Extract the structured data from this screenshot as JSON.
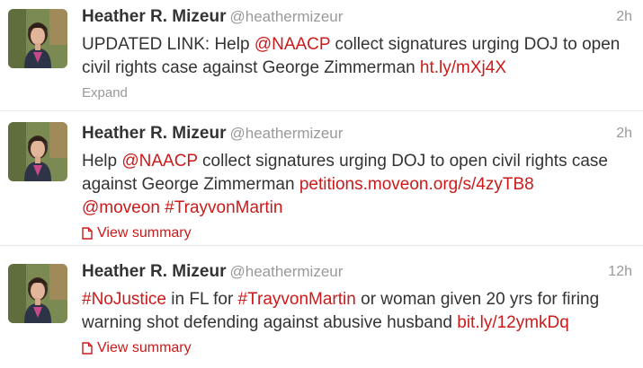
{
  "colors": {
    "link": "#cc1a1a",
    "muted": "#999999",
    "text": "#333333",
    "divider": "#e8e8e8"
  },
  "tweets": [
    {
      "fullname": "Heather R. Mizeur",
      "username": "@heathermizeur",
      "time": "2h",
      "avatar_icon": "profile-photo",
      "text": {
        "p1": "UPDATED LINK: Help ",
        "m1": "@NAACP",
        "p2": " collect signatures urging DOJ to open civil rights case against George Zimmerman ",
        "l1": "ht.ly/mXj4X"
      },
      "action": "Expand"
    },
    {
      "fullname": "Heather R. Mizeur",
      "username": "@heathermizeur",
      "time": "2h",
      "avatar_icon": "profile-photo",
      "text": {
        "p1": "Help ",
        "m1": "@NAACP",
        "p2": " collect signatures urging DOJ to open civil rights case against George Zimmerman ",
        "l1": "petitions.moveon.org/s/4zyTB8",
        "m2": "@moveon",
        "h1": "#TrayvonMartin"
      },
      "action": "View summary",
      "action_icon": "document-icon"
    },
    {
      "fullname": "Heather R. Mizeur",
      "username": "@heathermizeur",
      "time": "12h",
      "avatar_icon": "profile-photo",
      "text": {
        "h1": "#NoJustice",
        "p1": " in FL for ",
        "h2": "#TrayvonMartin",
        "p2": " or woman given 20 yrs for firing warning shot defending against abusive husband ",
        "l1": "bit.ly/12ymkDq"
      },
      "action": "View summary",
      "action_icon": "document-icon"
    }
  ]
}
